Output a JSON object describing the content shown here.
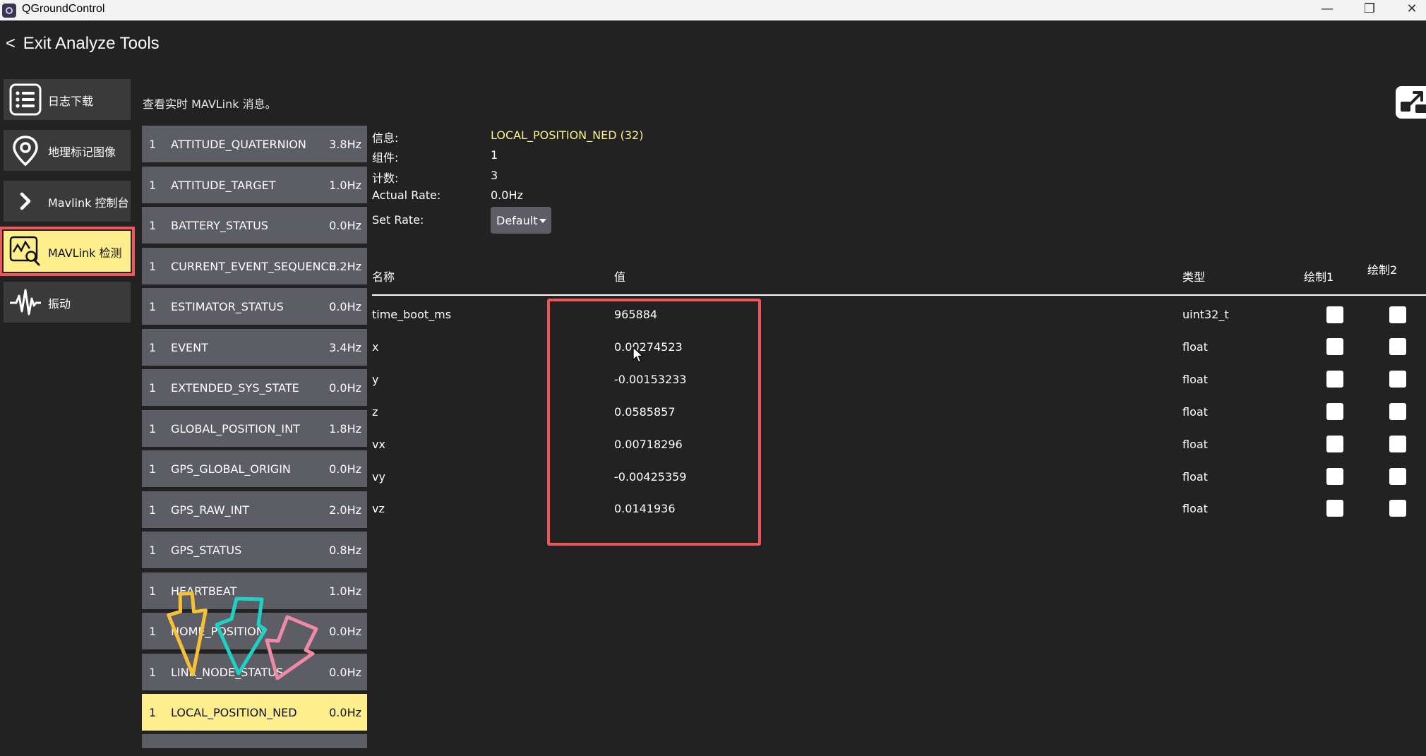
{
  "window": {
    "title": "QGroundControl",
    "minimize": "—",
    "restore": "❐",
    "close": "✕"
  },
  "header": {
    "back_chevron": "<",
    "back_label": "Exit Analyze Tools"
  },
  "nav": {
    "items": [
      {
        "label": "日志下载",
        "icon": "list-icon"
      },
      {
        "label": "地理标记图像",
        "icon": "map-pin-icon"
      },
      {
        "label": "Mavlink 控制台",
        "icon": "chevron-right-icon"
      },
      {
        "label": "MAVLink 检测",
        "icon": "chart-magnifier-icon",
        "active": true
      },
      {
        "label": "振动",
        "icon": "waveform-icon"
      }
    ]
  },
  "subtitle": "查看实时 MAVLink 消息。",
  "messages": [
    {
      "comp": "1",
      "name": "ATTITUDE_QUATERNION",
      "rate": "3.8Hz"
    },
    {
      "comp": "1",
      "name": "ATTITUDE_TARGET",
      "rate": "1.0Hz"
    },
    {
      "comp": "1",
      "name": "BATTERY_STATUS",
      "rate": "0.0Hz"
    },
    {
      "comp": "1",
      "name": "CURRENT_EVENT_SEQUENCE",
      "rate": "0.2Hz"
    },
    {
      "comp": "1",
      "name": "ESTIMATOR_STATUS",
      "rate": "0.0Hz"
    },
    {
      "comp": "1",
      "name": "EVENT",
      "rate": "3.4Hz"
    },
    {
      "comp": "1",
      "name": "EXTENDED_SYS_STATE",
      "rate": "0.0Hz"
    },
    {
      "comp": "1",
      "name": "GLOBAL_POSITION_INT",
      "rate": "1.8Hz"
    },
    {
      "comp": "1",
      "name": "GPS_GLOBAL_ORIGIN",
      "rate": "0.0Hz"
    },
    {
      "comp": "1",
      "name": "GPS_RAW_INT",
      "rate": "2.0Hz"
    },
    {
      "comp": "1",
      "name": "GPS_STATUS",
      "rate": "0.8Hz"
    },
    {
      "comp": "1",
      "name": "HEARTBEAT",
      "rate": "1.0Hz"
    },
    {
      "comp": "1",
      "name": "HOME_POSITION",
      "rate": "0.0Hz"
    },
    {
      "comp": "1",
      "name": "LINK_NODE_STATUS",
      "rate": "0.0Hz"
    },
    {
      "comp": "1",
      "name": "LOCAL_POSITION_NED",
      "rate": "0.0Hz",
      "selected": true
    }
  ],
  "info": {
    "message_label": "信息:",
    "message_value": "LOCAL_POSITION_NED (32)",
    "component_label": "组件:",
    "component_value": "1",
    "count_label": "计数:",
    "count_value": "3",
    "actual_rate_label": "Actual Rate:",
    "actual_rate_value": "0.0Hz",
    "set_rate_label": "Set Rate:",
    "set_rate_value": "Default"
  },
  "table": {
    "headers": {
      "name": "名称",
      "value": "值",
      "type": "类型",
      "plot1": "绘制1",
      "plot2": "绘制2"
    },
    "rows": [
      {
        "name": "time_boot_ms",
        "value": "965884",
        "type": "uint32_t"
      },
      {
        "name": "x",
        "value": "0.00274523",
        "type": "float"
      },
      {
        "name": "y",
        "value": "-0.00153233",
        "type": "float"
      },
      {
        "name": "z",
        "value": "0.0585857",
        "type": "float"
      },
      {
        "name": "vx",
        "value": "0.00718296",
        "type": "float"
      },
      {
        "name": "vy",
        "value": "-0.00425359",
        "type": "float"
      },
      {
        "name": "vz",
        "value": "0.0141936",
        "type": "float"
      }
    ]
  },
  "colors": {
    "background": "#222222",
    "list_item": "#5d5d66",
    "selected": "#ffee8c",
    "annotation_red": "#ef5659",
    "arrow_yellow": "#f6c233",
    "arrow_teal": "#1ed3c6",
    "arrow_pink": "#ee8aa5"
  }
}
